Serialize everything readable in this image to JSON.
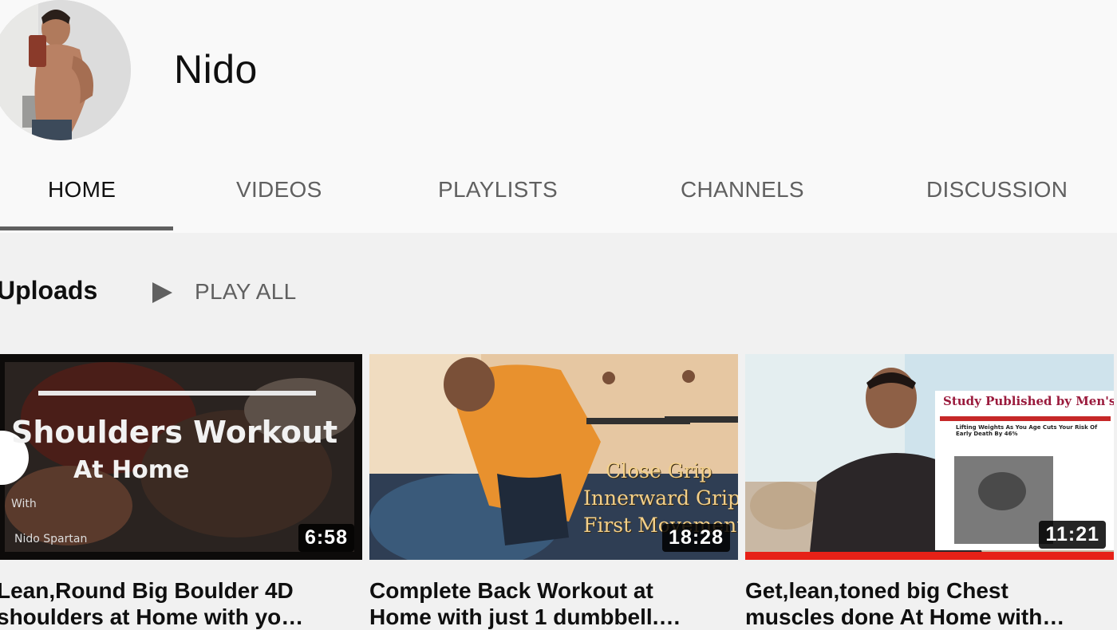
{
  "channel": {
    "name": "Nido"
  },
  "tabs": [
    {
      "label": "HOME",
      "active": true
    },
    {
      "label": "VIDEOS",
      "active": false
    },
    {
      "label": "PLAYLISTS",
      "active": false
    },
    {
      "label": "CHANNELS",
      "active": false
    },
    {
      "label": "DISCUSSION",
      "active": false
    }
  ],
  "shelf": {
    "title": "Uploads",
    "play_all_label": "PLAY ALL",
    "play_all_icon": "play-icon"
  },
  "videos": [
    {
      "title_line1": "Lean,Round Big Boulder 4D",
      "title_line2": "shoulders at Home with yo…",
      "duration": "6:58",
      "overlay_title": "Shoulders Workout",
      "overlay_subtitle": "At Home",
      "overlay_with": "With",
      "overlay_credit": "Nido Spartan"
    },
    {
      "title_line1": "Complete Back Workout at",
      "title_line2": "Home with just 1 dumbbell.…",
      "duration": "18:28",
      "overlay_line1": "Close Grip",
      "overlay_line2": "Innerward Grip",
      "overlay_line3": "First Movement"
    },
    {
      "title_line1": "Get,lean,toned big Chest",
      "title_line2": "muscles done At Home with…",
      "duration": "11:21",
      "watched_fraction": 1.0,
      "overlay_headline": "Study Published by Men's Health",
      "overlay_article": "Lifting Weights As You Age Cuts Your Risk Of Early Death By 46%"
    }
  ],
  "colors": {
    "header_bg": "#f9f9f9",
    "page_bg": "#f1f1f1",
    "progress_red": "#e62117"
  }
}
